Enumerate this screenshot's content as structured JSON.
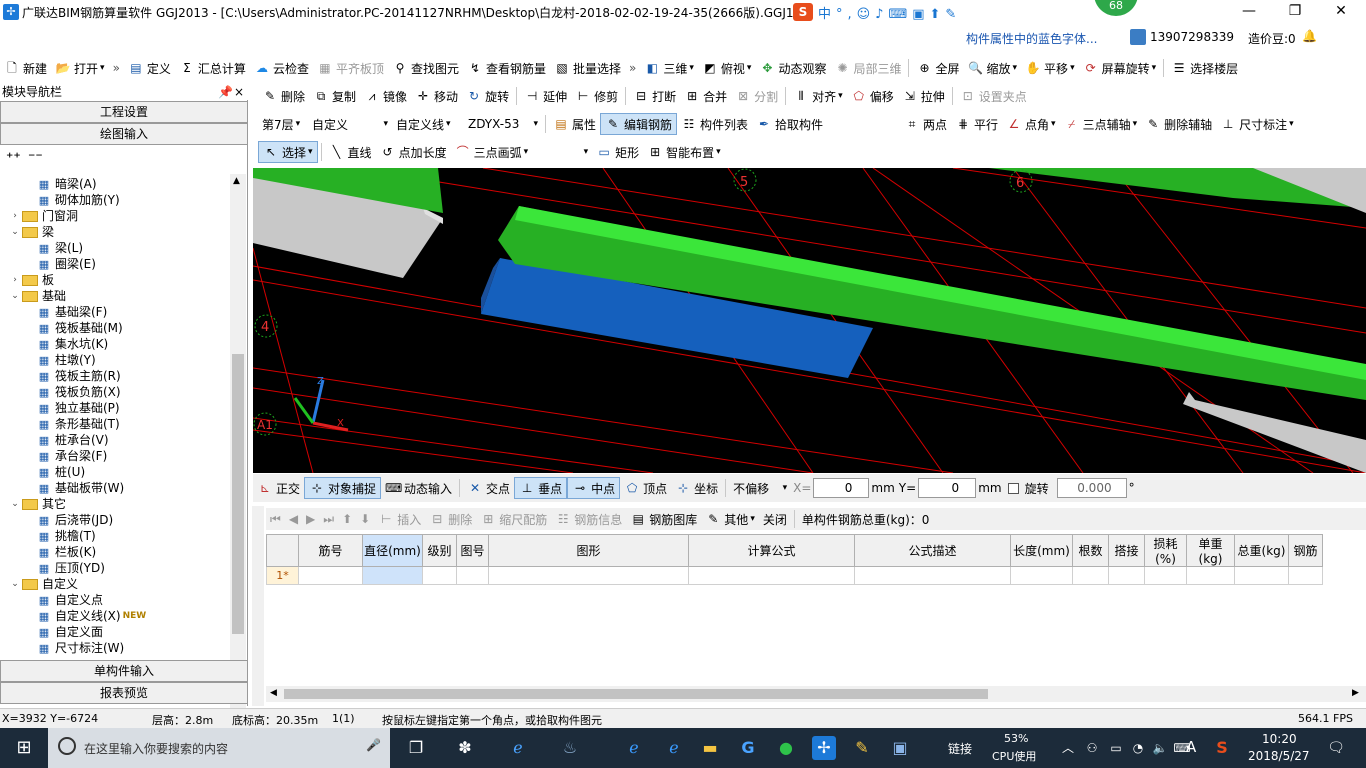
{
  "window": {
    "title": "广联达BIM钢筋算量软件 GGJ2013 - [C:\\Users\\Administrator.PC-20141127NRHM\\Desktop\\白龙村-2018-02-02-19-24-35(2666版).GGJ12]",
    "score_badge": "68"
  },
  "sub": {
    "hint": "构件属性中的蓝色字体...",
    "phone": "13907298339",
    "credits": "造价豆:0"
  },
  "main_toolbar": [
    "新建",
    "打开",
    "定义",
    "汇总计算",
    "云检查",
    "平齐板顶",
    "查找图元",
    "查看钢筋量",
    "批量选择",
    "三维",
    "俯视",
    "动态观察",
    "局部三维",
    "全屏",
    "缩放",
    "平移",
    "屏幕旋转",
    "选择楼层"
  ],
  "edit_toolbar": [
    "删除",
    "复制",
    "镜像",
    "移动",
    "旋转",
    "延伸",
    "修剪",
    "打断",
    "合并",
    "分割",
    "对齐",
    "偏移",
    "拉伸",
    "设置夹点"
  ],
  "floor_toolbar": {
    "floor": "第7层",
    "type": "自定义",
    "subtype": "自定义线",
    "code": "ZDYX-53",
    "buttons": [
      "属性",
      "编辑钢筋",
      "构件列表",
      "拾取构件"
    ],
    "axis": [
      "两点",
      "平行",
      "点角",
      "三点辅轴",
      "删除辅轴",
      "尺寸标注"
    ]
  },
  "draw_toolbar": [
    "选择",
    "直线",
    "点加长度",
    "三点画弧",
    "矩形",
    "智能布置"
  ],
  "left_panel": {
    "title": "模块导航栏",
    "pin": "ᵖ",
    "close": "×",
    "btn1": "工程设置",
    "btn2": "绘图输入",
    "btn_bottom1": "单构件输入",
    "btn_bottom2": "报表预览",
    "tree": [
      {
        "t": "暗梁(A)",
        "lvl": 2,
        "ico": "leaf"
      },
      {
        "t": "砌体加筋(Y)",
        "lvl": 2,
        "ico": "leaf"
      },
      {
        "t": "门窗洞",
        "lvl": 1,
        "ico": "folder",
        "exp": "›"
      },
      {
        "t": "梁",
        "lvl": 1,
        "ico": "folder",
        "exp": "⌄"
      },
      {
        "t": "梁(L)",
        "lvl": 2,
        "ico": "leaf"
      },
      {
        "t": "圈梁(E)",
        "lvl": 2,
        "ico": "leaf"
      },
      {
        "t": "板",
        "lvl": 1,
        "ico": "folder",
        "exp": "›"
      },
      {
        "t": "基础",
        "lvl": 1,
        "ico": "folder",
        "exp": "⌄"
      },
      {
        "t": "基础梁(F)",
        "lvl": 2,
        "ico": "leaf"
      },
      {
        "t": "筏板基础(M)",
        "lvl": 2,
        "ico": "leaf"
      },
      {
        "t": "集水坑(K)",
        "lvl": 2,
        "ico": "leaf"
      },
      {
        "t": "柱墩(Y)",
        "lvl": 2,
        "ico": "leaf"
      },
      {
        "t": "筏板主筋(R)",
        "lvl": 2,
        "ico": "leaf"
      },
      {
        "t": "筏板负筋(X)",
        "lvl": 2,
        "ico": "leaf"
      },
      {
        "t": "独立基础(P)",
        "lvl": 2,
        "ico": "leaf"
      },
      {
        "t": "条形基础(T)",
        "lvl": 2,
        "ico": "leaf"
      },
      {
        "t": "桩承台(V)",
        "lvl": 2,
        "ico": "leaf"
      },
      {
        "t": "承台梁(F)",
        "lvl": 2,
        "ico": "leaf"
      },
      {
        "t": "桩(U)",
        "lvl": 2,
        "ico": "leaf"
      },
      {
        "t": "基础板带(W)",
        "lvl": 2,
        "ico": "leaf"
      },
      {
        "t": "其它",
        "lvl": 1,
        "ico": "folder",
        "exp": "⌄"
      },
      {
        "t": "后浇带(JD)",
        "lvl": 2,
        "ico": "leaf"
      },
      {
        "t": "挑檐(T)",
        "lvl": 2,
        "ico": "leaf"
      },
      {
        "t": "栏板(K)",
        "lvl": 2,
        "ico": "leaf"
      },
      {
        "t": "压顶(YD)",
        "lvl": 2,
        "ico": "leaf"
      },
      {
        "t": "自定义",
        "lvl": 1,
        "ico": "folder",
        "exp": "⌄"
      },
      {
        "t": "自定义点",
        "lvl": 2,
        "ico": "leaf"
      },
      {
        "t": "自定义线(X)",
        "lvl": 2,
        "ico": "leaf",
        "new": "NEW"
      },
      {
        "t": "自定义面",
        "lvl": 2,
        "ico": "leaf"
      },
      {
        "t": "尺寸标注(W)",
        "lvl": 2,
        "ico": "leaf"
      }
    ]
  },
  "viewport": {
    "axis_labels": [
      "5",
      "6",
      "4",
      "A1"
    ]
  },
  "snap_toolbar": [
    "正交",
    "对象捕捉",
    "动态输入",
    "交点",
    "垂点",
    "中点",
    "顶点",
    "坐标"
  ],
  "snap": {
    "offset": "不偏移",
    "x_label": "X=",
    "x": "0",
    "y_label": "Y=",
    "y": "0",
    "mm": "mm",
    "rotate": "旋转",
    "angle": "0.000",
    "deg": "°"
  },
  "grid_toolbar": [
    "插入",
    "删除",
    "缩尺配筋",
    "钢筋信息",
    "钢筋图库",
    "其他",
    "关闭"
  ],
  "grid_total": "单构件钢筋总重(kg)：0",
  "grid": {
    "headers": [
      "筋号",
      "直径(mm)",
      "级别",
      "图号",
      "图形",
      "计算公式",
      "公式描述",
      "长度(mm)",
      "根数",
      "搭接",
      "损耗(%)",
      "单重(kg)",
      "总重(kg)",
      "钢筋"
    ],
    "row1": "1*"
  },
  "status": {
    "coords": "X=3932 Y=-6724",
    "floor_h": "层高：2.8m",
    "base_h": "底标高：20.35m",
    "count": "1(1)",
    "hint": "按鼠标左键指定第一个角点，或拾取构件图元",
    "fps": "564.1 FPS"
  },
  "taskbar": {
    "search": "在这里输入你要搜索的内容",
    "link": "链接",
    "cpu": "53%",
    "cpu_label": "CPU使用",
    "time": "10:20",
    "date": "2018/5/27",
    "ime": "A"
  }
}
